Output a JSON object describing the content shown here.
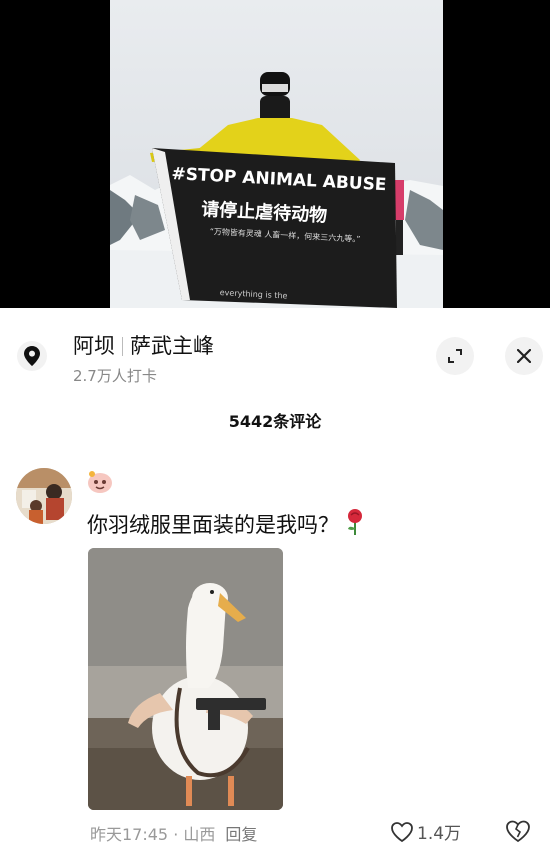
{
  "video": {
    "banner_line1": "#STOP ANIMAL ABUSE",
    "banner_line2": "请停止虐待动物",
    "banner_line3": "“万物皆有灵魂 人畜一样，何来三六九等。”",
    "banner_line4": "everything is the"
  },
  "location": {
    "region": "阿坝",
    "place": "萨武主峰",
    "checkins": "2.7万人打卡",
    "pin_icon": "location-pin-icon",
    "expand_icon": "expand-icon",
    "close_icon": "close-icon"
  },
  "comments": {
    "count_label": "5442条评论",
    "items": [
      {
        "text": "你羽绒服里面装的是我吗？",
        "time": "昨天17:45 · 山西",
        "reply_label": "回复",
        "likes": "1.4万"
      }
    ]
  },
  "colors": {
    "background": "#ffffff",
    "banner": "#1c1c1c",
    "jacket": "#e3d21a",
    "meta_text": "#999999"
  }
}
